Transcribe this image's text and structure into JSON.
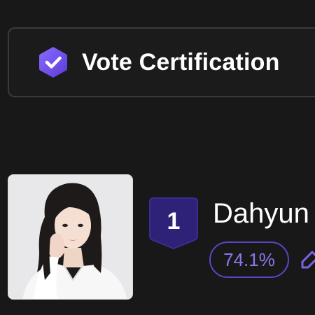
{
  "vote_certification": {
    "label": "Vote Certification",
    "icon": "hexagon-check-icon",
    "accent_color": "#6c4ee8"
  },
  "ranking": {
    "rank": "1",
    "name": "Dahyun",
    "percent": "74.1%",
    "accent_color": "#5b45c6",
    "badge_color": "#2e2278"
  }
}
